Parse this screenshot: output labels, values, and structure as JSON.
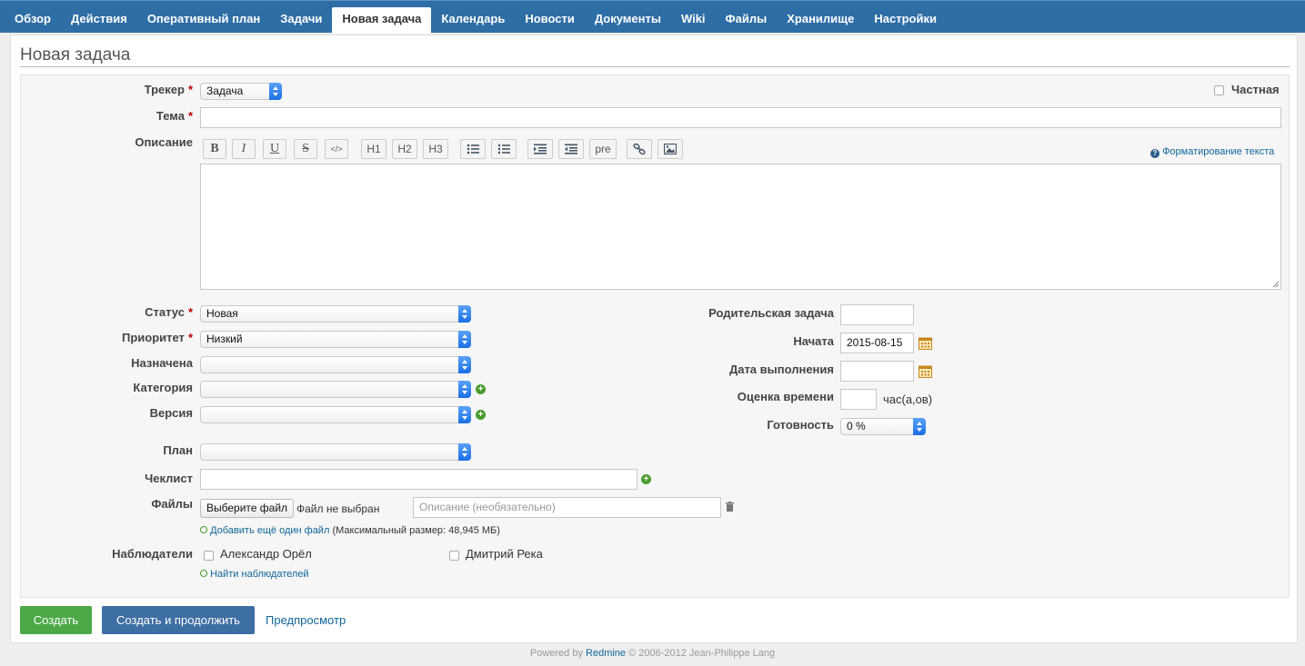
{
  "nav": {
    "tabs": [
      {
        "label": "Обзор"
      },
      {
        "label": "Действия"
      },
      {
        "label": "Оперативный план"
      },
      {
        "label": "Задачи"
      },
      {
        "label": "Новая задача"
      },
      {
        "label": "Календарь"
      },
      {
        "label": "Новости"
      },
      {
        "label": "Документы"
      },
      {
        "label": "Wiki"
      },
      {
        "label": "Файлы"
      },
      {
        "label": "Хранилище"
      },
      {
        "label": "Настройки"
      }
    ],
    "active_index": 4
  },
  "page": {
    "title": "Новая задача"
  },
  "form": {
    "tracker": {
      "label": "Трекер",
      "value": "Задача"
    },
    "private": {
      "label": "Частная",
      "checked": false
    },
    "subject": {
      "label": "Тема",
      "value": ""
    },
    "description": {
      "label": "Описание",
      "value": ""
    },
    "toolbar": {
      "bold": "B",
      "italic": "I",
      "underline": "U",
      "strike": "S",
      "code": "</>",
      "h1": "H1",
      "h2": "H2",
      "h3": "H3",
      "pre": "pre",
      "help_link": "Форматирование текста"
    },
    "status": {
      "label": "Статус",
      "value": "Новая"
    },
    "priority": {
      "label": "Приоритет",
      "value": "Низкий"
    },
    "assignee": {
      "label": "Назначена",
      "value": ""
    },
    "category": {
      "label": "Категория",
      "value": ""
    },
    "version": {
      "label": "Версия",
      "value": ""
    },
    "plan": {
      "label": "План",
      "value": ""
    },
    "parent": {
      "label": "Родительская задача",
      "value": ""
    },
    "start_date": {
      "label": "Начата",
      "value": "2015-08-15"
    },
    "due_date": {
      "label": "Дата выполнения",
      "value": ""
    },
    "estimate": {
      "label": "Оценка времени",
      "value": "",
      "unit": "час(а,ов)"
    },
    "done_ratio": {
      "label": "Готовность",
      "value": "0 %"
    },
    "checklist": {
      "label": "Чеклист",
      "value": ""
    },
    "files": {
      "label": "Файлы",
      "choose_button": "Выберите файл",
      "no_file": "Файл не выбран",
      "description_placeholder": "Описание (необязательно)",
      "add_another": "Добавить ещё один файл",
      "max_size": "(Максимальный размер: 48,945 МБ)"
    },
    "watchers": {
      "label": "Наблюдатели",
      "users": [
        {
          "name": "Александр Орёл",
          "checked": false
        },
        {
          "name": "Дмитрий Река",
          "checked": false
        }
      ],
      "search_link": "Найти наблюдателей"
    }
  },
  "actions": {
    "create": "Создать",
    "create_continue": "Создать и продолжить",
    "preview": "Предпросмотр"
  },
  "footer": {
    "powered_by": "Powered by",
    "product": "Redmine",
    "copyright": "© 2006-2012 Jean-Philippe Lang"
  },
  "colors": {
    "nav_bg": "#2e6ea6",
    "create_button": "#4ca847",
    "continue_button": "#3e6fa3",
    "link": "#116699",
    "required": "#bb0000"
  }
}
